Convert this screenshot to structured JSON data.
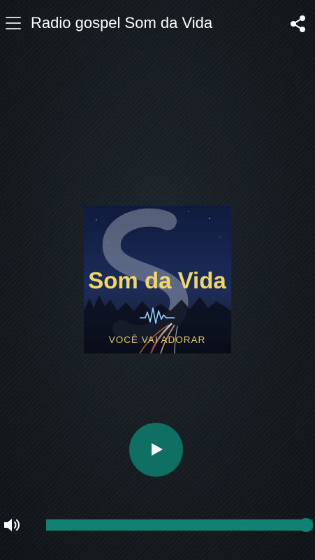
{
  "app_bar": {
    "title": "Radio gospel Som da Vida",
    "menu_icon": "hamburger-menu-icon",
    "share_icon": "share-icon"
  },
  "cover": {
    "brand": "Som da Vida",
    "tagline": "VOCÊ VAI ADORAR"
  },
  "player": {
    "play_icon": "play-icon",
    "volume_icon": "volume-icon",
    "volume_level": 1.0
  },
  "colors": {
    "accent": "#0f8272",
    "play_button": "#0e6f62",
    "brand_text": "#f1d66a",
    "tagline_text": "#e3c766"
  }
}
